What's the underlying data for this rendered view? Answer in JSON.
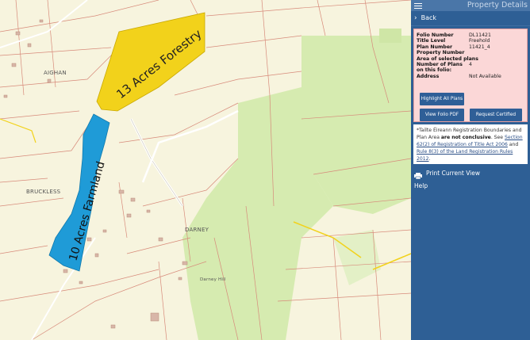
{
  "map": {
    "places": {
      "aighan": "AIGHAN",
      "bruckless": "BRUCKLESS",
      "darney": "DARNEY",
      "darney_hill": "Darney Hill"
    },
    "parcels": {
      "forestry_label": "13 Acres Forestry",
      "farmland_label": "10 Acres Farmland"
    },
    "colors": {
      "forestry": "#f2d21b",
      "farmland": "#1f9bd7",
      "woodland": "#d6ebb0",
      "background": "#f7f4de",
      "boundary": "#d78a7a"
    }
  },
  "panel": {
    "title": "Property Details",
    "back_label": "Back",
    "details": [
      {
        "label": "Folio Number",
        "value": "DL11421"
      },
      {
        "label": "Title Level",
        "value": "Freehold"
      },
      {
        "label": "Plan Number",
        "value": "11421_4"
      },
      {
        "label": "Property Number",
        "value": ""
      },
      {
        "label": "Area of selected plans",
        "value": ""
      },
      {
        "label": "Number of Plans on this folio:",
        "value": "4"
      },
      {
        "label": "Address",
        "value": "Not Available"
      }
    ],
    "buttons": {
      "highlight": "Highlight All Plans",
      "view_pdf": "View Folio PDF",
      "request_copy": "Request Certified Copy"
    },
    "note": {
      "prefix": "*Tailte Éireann Registration Boundaries and Plan Area ",
      "bold": "are not conclusive",
      "mid": ". See ",
      "link1": "Section 62(2) of Registration of Title Act 2006",
      "and": " and ",
      "link2": "Rule 8(3) of the Land Registration Rules 2012",
      "end": "."
    },
    "menu": {
      "print": "Print Current View",
      "help": "Help"
    },
    "colors": {
      "panel_bg": "#2e5f95",
      "details_bg": "#fbd7d7",
      "button_bg": "#2f5f97"
    }
  }
}
